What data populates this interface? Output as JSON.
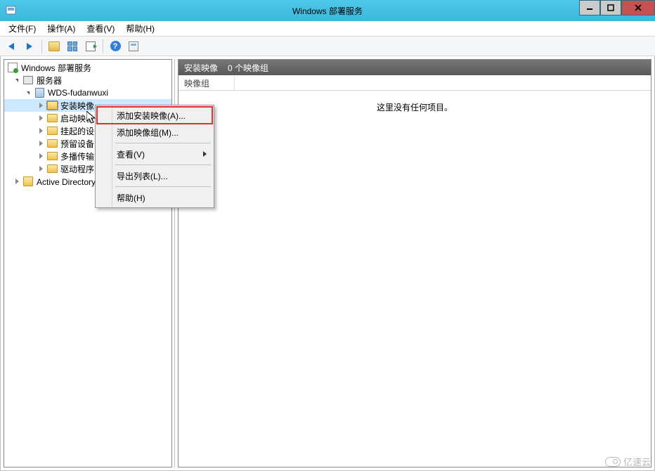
{
  "window": {
    "title": "Windows 部署服务"
  },
  "menu": {
    "file": "文件(F)",
    "action": "操作(A)",
    "view": "查看(V)",
    "help": "帮助(H)"
  },
  "tree": {
    "root": "Windows 部署服务",
    "servers_group": "服务器",
    "server_name": "WDS-fudanwuxi",
    "nodes": {
      "install_images": "安装映像",
      "boot_images": "启动映像",
      "pending_devices": "挂起的设备",
      "prestaged_devices": "预留设备",
      "multicast": "多播传输",
      "drivers": "驱动程序"
    },
    "ad": "Active Directory 预留设备"
  },
  "list": {
    "header_title": "安装映像",
    "header_count": "0 个映像组",
    "column1": "映像组",
    "empty_text": "这里没有任何项目。"
  },
  "context_menu": {
    "add_install_image": "添加安装映像(A)...",
    "add_image_group": "添加映像组(M)...",
    "view": "查看(V)",
    "export_list": "导出列表(L)...",
    "help": "帮助(H)"
  },
  "watermark": "亿速云"
}
